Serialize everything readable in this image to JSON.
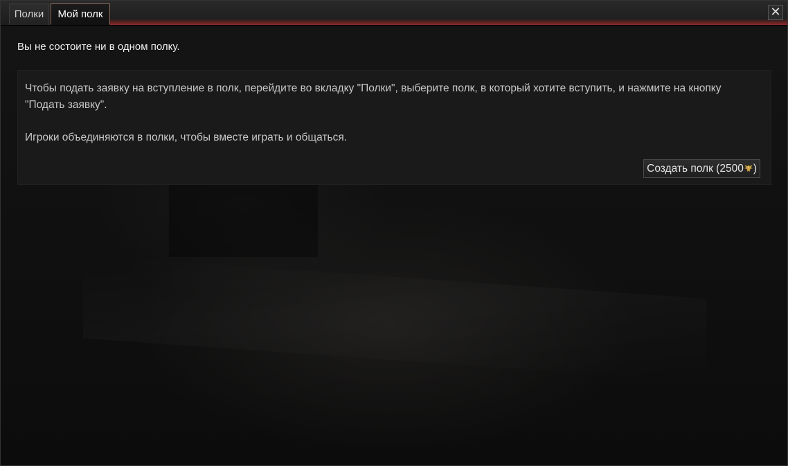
{
  "tabs": [
    {
      "label": "Полки",
      "active": false
    },
    {
      "label": "Мой полк",
      "active": true
    }
  ],
  "close_icon": "close-icon",
  "status_message": "Вы не состоите ни в одном полку.",
  "info": {
    "paragraph_1": "Чтобы подать заявку на вступление в полк, перейдите во вкладку \"Полки\", выберите полк, в который хотите вступить, и нажмите на кнопку \"Подать заявку\".",
    "paragraph_2": "Игроки объединяются в полки, чтобы вместе играть и общаться."
  },
  "create_button": {
    "label_prefix": "Создать полк (2500",
    "label_suffix": ")",
    "currency_icon": "golden-eagle-icon"
  },
  "colors": {
    "accent_glow": "#a52828",
    "text_primary": "#f0f0f0",
    "text_secondary": "#c8c8c8",
    "currency_gold": "#c9a14a"
  }
}
